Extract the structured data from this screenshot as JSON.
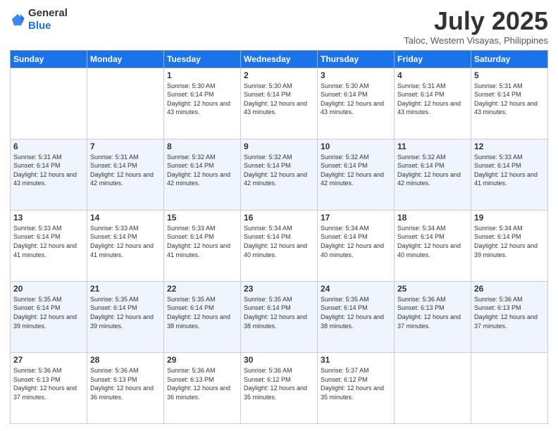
{
  "logo": {
    "general": "General",
    "blue": "Blue"
  },
  "header": {
    "month": "July 2025",
    "location": "Taloc, Western Visayas, Philippines"
  },
  "days_of_week": [
    "Sunday",
    "Monday",
    "Tuesday",
    "Wednesday",
    "Thursday",
    "Friday",
    "Saturday"
  ],
  "weeks": [
    [
      {
        "day": "",
        "info": ""
      },
      {
        "day": "",
        "info": ""
      },
      {
        "day": "1",
        "info": "Sunrise: 5:30 AM\nSunset: 6:14 PM\nDaylight: 12 hours and 43 minutes."
      },
      {
        "day": "2",
        "info": "Sunrise: 5:30 AM\nSunset: 6:14 PM\nDaylight: 12 hours and 43 minutes."
      },
      {
        "day": "3",
        "info": "Sunrise: 5:30 AM\nSunset: 6:14 PM\nDaylight: 12 hours and 43 minutes."
      },
      {
        "day": "4",
        "info": "Sunrise: 5:31 AM\nSunset: 6:14 PM\nDaylight: 12 hours and 43 minutes."
      },
      {
        "day": "5",
        "info": "Sunrise: 5:31 AM\nSunset: 6:14 PM\nDaylight: 12 hours and 43 minutes."
      }
    ],
    [
      {
        "day": "6",
        "info": "Sunrise: 5:31 AM\nSunset: 6:14 PM\nDaylight: 12 hours and 43 minutes."
      },
      {
        "day": "7",
        "info": "Sunrise: 5:31 AM\nSunset: 6:14 PM\nDaylight: 12 hours and 42 minutes."
      },
      {
        "day": "8",
        "info": "Sunrise: 5:32 AM\nSunset: 6:14 PM\nDaylight: 12 hours and 42 minutes."
      },
      {
        "day": "9",
        "info": "Sunrise: 5:32 AM\nSunset: 6:14 PM\nDaylight: 12 hours and 42 minutes."
      },
      {
        "day": "10",
        "info": "Sunrise: 5:32 AM\nSunset: 6:14 PM\nDaylight: 12 hours and 42 minutes."
      },
      {
        "day": "11",
        "info": "Sunrise: 5:32 AM\nSunset: 6:14 PM\nDaylight: 12 hours and 42 minutes."
      },
      {
        "day": "12",
        "info": "Sunrise: 5:33 AM\nSunset: 6:14 PM\nDaylight: 12 hours and 41 minutes."
      }
    ],
    [
      {
        "day": "13",
        "info": "Sunrise: 5:33 AM\nSunset: 6:14 PM\nDaylight: 12 hours and 41 minutes."
      },
      {
        "day": "14",
        "info": "Sunrise: 5:33 AM\nSunset: 6:14 PM\nDaylight: 12 hours and 41 minutes."
      },
      {
        "day": "15",
        "info": "Sunrise: 5:33 AM\nSunset: 6:14 PM\nDaylight: 12 hours and 41 minutes."
      },
      {
        "day": "16",
        "info": "Sunrise: 5:34 AM\nSunset: 6:14 PM\nDaylight: 12 hours and 40 minutes."
      },
      {
        "day": "17",
        "info": "Sunrise: 5:34 AM\nSunset: 6:14 PM\nDaylight: 12 hours and 40 minutes."
      },
      {
        "day": "18",
        "info": "Sunrise: 5:34 AM\nSunset: 6:14 PM\nDaylight: 12 hours and 40 minutes."
      },
      {
        "day": "19",
        "info": "Sunrise: 5:34 AM\nSunset: 6:14 PM\nDaylight: 12 hours and 39 minutes."
      }
    ],
    [
      {
        "day": "20",
        "info": "Sunrise: 5:35 AM\nSunset: 6:14 PM\nDaylight: 12 hours and 39 minutes."
      },
      {
        "day": "21",
        "info": "Sunrise: 5:35 AM\nSunset: 6:14 PM\nDaylight: 12 hours and 39 minutes."
      },
      {
        "day": "22",
        "info": "Sunrise: 5:35 AM\nSunset: 6:14 PM\nDaylight: 12 hours and 38 minutes."
      },
      {
        "day": "23",
        "info": "Sunrise: 5:35 AM\nSunset: 6:14 PM\nDaylight: 12 hours and 38 minutes."
      },
      {
        "day": "24",
        "info": "Sunrise: 5:35 AM\nSunset: 6:14 PM\nDaylight: 12 hours and 38 minutes."
      },
      {
        "day": "25",
        "info": "Sunrise: 5:36 AM\nSunset: 6:13 PM\nDaylight: 12 hours and 37 minutes."
      },
      {
        "day": "26",
        "info": "Sunrise: 5:36 AM\nSunset: 6:13 PM\nDaylight: 12 hours and 37 minutes."
      }
    ],
    [
      {
        "day": "27",
        "info": "Sunrise: 5:36 AM\nSunset: 6:13 PM\nDaylight: 12 hours and 37 minutes."
      },
      {
        "day": "28",
        "info": "Sunrise: 5:36 AM\nSunset: 6:13 PM\nDaylight: 12 hours and 36 minutes."
      },
      {
        "day": "29",
        "info": "Sunrise: 5:36 AM\nSunset: 6:13 PM\nDaylight: 12 hours and 36 minutes."
      },
      {
        "day": "30",
        "info": "Sunrise: 5:36 AM\nSunset: 6:12 PM\nDaylight: 12 hours and 35 minutes."
      },
      {
        "day": "31",
        "info": "Sunrise: 5:37 AM\nSunset: 6:12 PM\nDaylight: 12 hours and 35 minutes."
      },
      {
        "day": "",
        "info": ""
      },
      {
        "day": "",
        "info": ""
      }
    ]
  ]
}
